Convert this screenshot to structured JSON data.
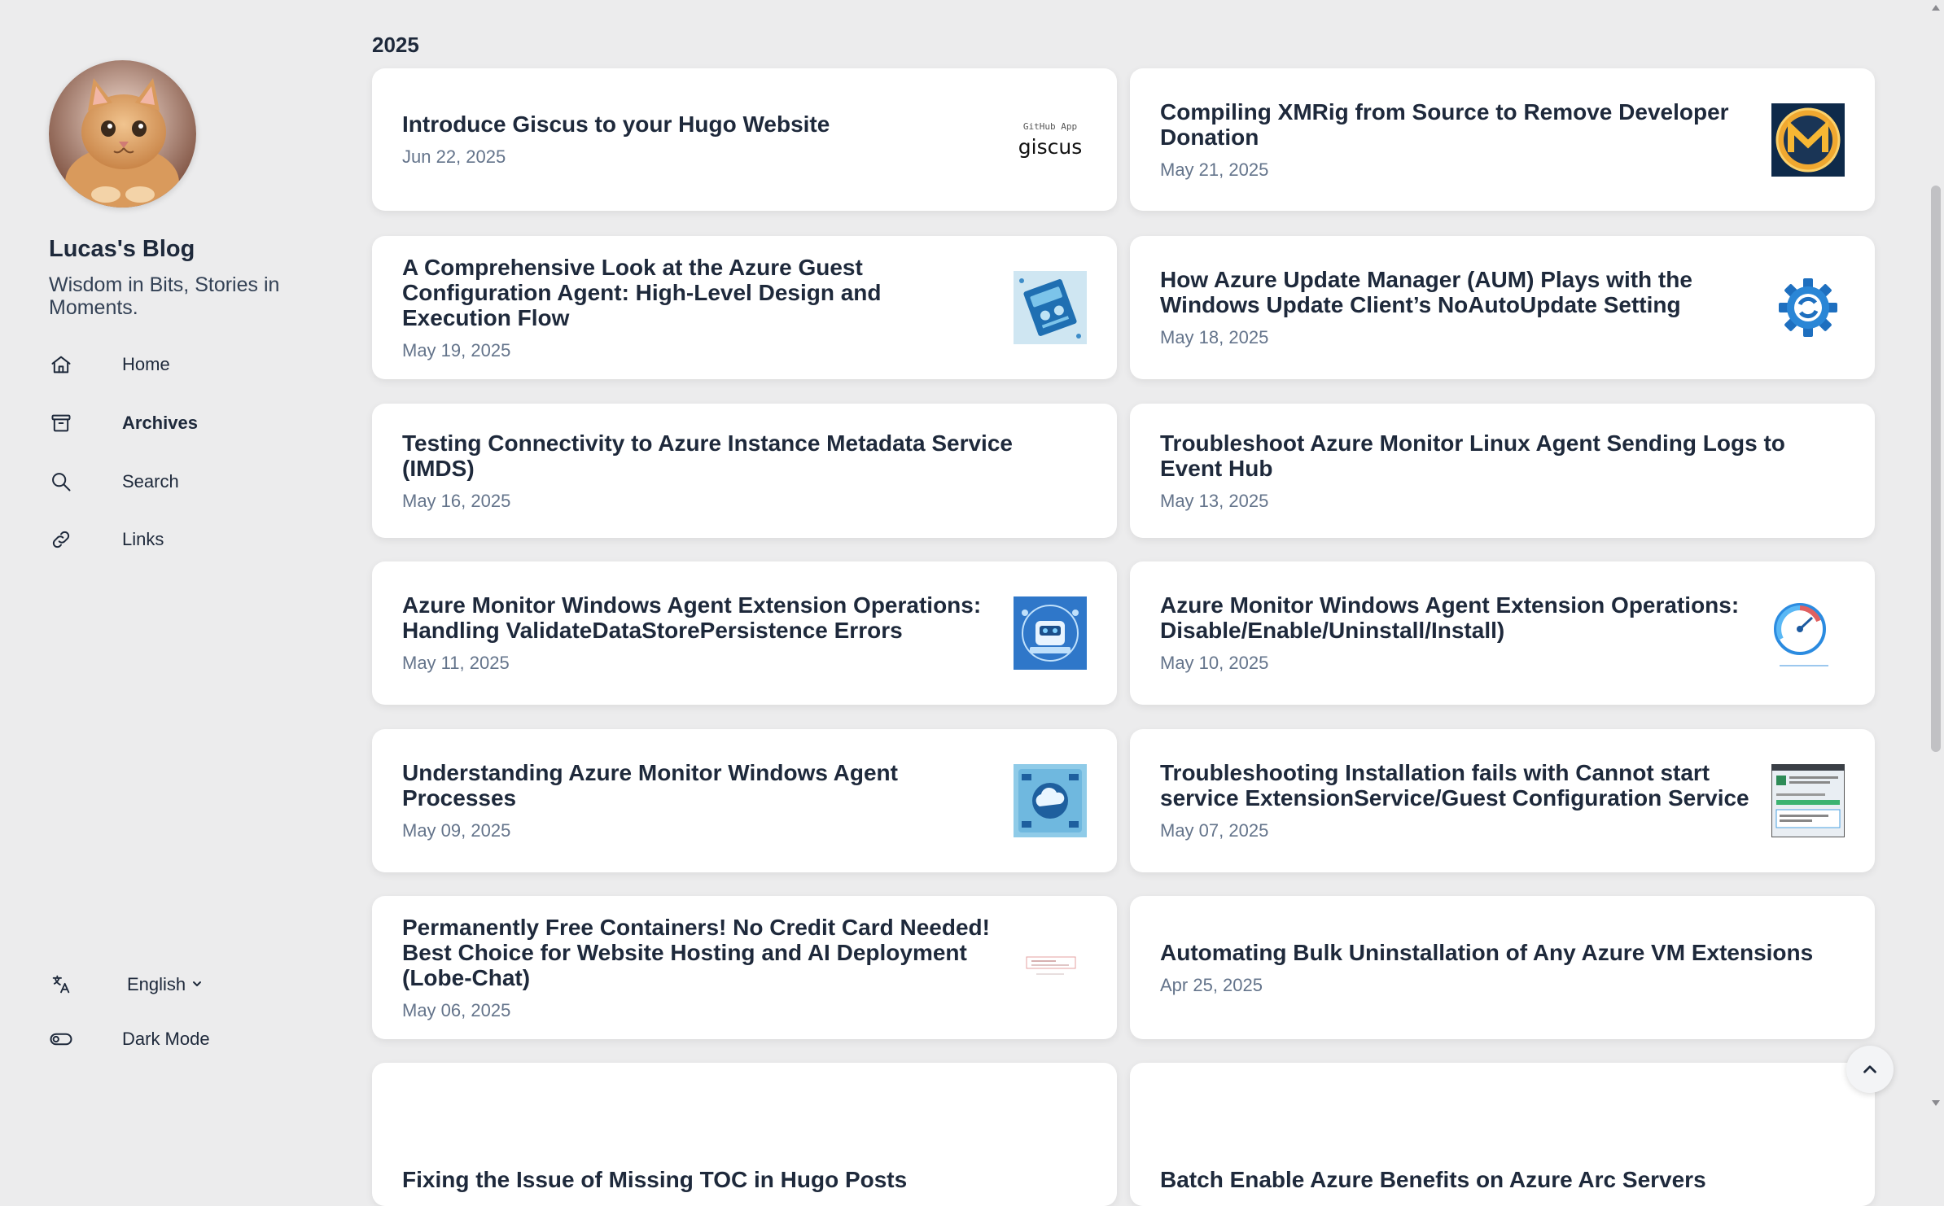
{
  "site": {
    "title": "Lucas's Blog",
    "description": "Wisdom in Bits, Stories in Moments."
  },
  "nav": {
    "items": [
      {
        "label": "Home",
        "icon": "home-icon"
      },
      {
        "label": "Archives",
        "icon": "archive-icon",
        "active": true
      },
      {
        "label": "Search",
        "icon": "search-icon"
      },
      {
        "label": "Links",
        "icon": "link-icon"
      }
    ]
  },
  "footer": {
    "language": "English",
    "dark_mode": "Dark Mode"
  },
  "archive": {
    "year": "2025",
    "posts": [
      {
        "title": "Introduce Giscus to your Hugo Website",
        "date": "Jun 22, 2025",
        "thumb": "giscus",
        "thumb_line1": "GitHub App",
        "thumb_line2": "giscus"
      },
      {
        "title": "Compiling XMRig from Source to Remove Developer Donation",
        "date": "May 21, 2025",
        "thumb": "monero"
      },
      {
        "title": "A Comprehensive Look at the Azure Guest Configuration Agent: High-Level Design and Execution Flow",
        "date": "May 19, 2025",
        "thumb": "book"
      },
      {
        "title": "How Azure Update Manager (AUM) Plays with the Windows Update Client’s NoAutoUpdate Setting",
        "date": "May 18, 2025",
        "thumb": "update"
      },
      {
        "title": "Testing Connectivity to Azure Instance Metadata Service (IMDS)",
        "date": "May 16, 2025",
        "thumb": "none"
      },
      {
        "title": "Troubleshoot Azure Monitor Linux Agent Sending Logs to Event Hub",
        "date": "May 13, 2025",
        "thumb": "none"
      },
      {
        "title": "Azure Monitor Windows Agent Extension Operations: Handling ValidateDataStorePersistence Errors",
        "date": "May 11, 2025",
        "thumb": "robot"
      },
      {
        "title": "Azure Monitor Windows Agent Extension Operations: Disable/Enable/Uninstall/Install)",
        "date": "May 10, 2025",
        "thumb": "gauge"
      },
      {
        "title": "Understanding Azure Monitor Windows Agent Processes",
        "date": "May 09, 2025",
        "thumb": "cloud"
      },
      {
        "title": "Troubleshooting Installation fails with Cannot start service ExtensionService/Guest Configuration Service",
        "date": "May 07, 2025",
        "thumb": "installer"
      },
      {
        "title": "Permanently Free Containers! No Credit Card Needed! Best Choice for Website Hosting and AI Deployment (Lobe-Chat)",
        "date": "May 06, 2025",
        "thumb": "screenshot"
      },
      {
        "title": "Automating Bulk Uninstallation of Any Azure VM Extensions",
        "date": "Apr 25, 2025",
        "thumb": "none"
      },
      {
        "title": "Fixing the Issue of Missing TOC in Hugo Posts",
        "date": "",
        "thumb": "none"
      },
      {
        "title": "Batch Enable Azure Benefits on Azure Arc Servers",
        "date": "",
        "thumb": "none"
      }
    ]
  },
  "colors": {
    "background": "#ececed",
    "card": "#ffffff",
    "text": "#1e293b",
    "muted": "#64748b"
  }
}
